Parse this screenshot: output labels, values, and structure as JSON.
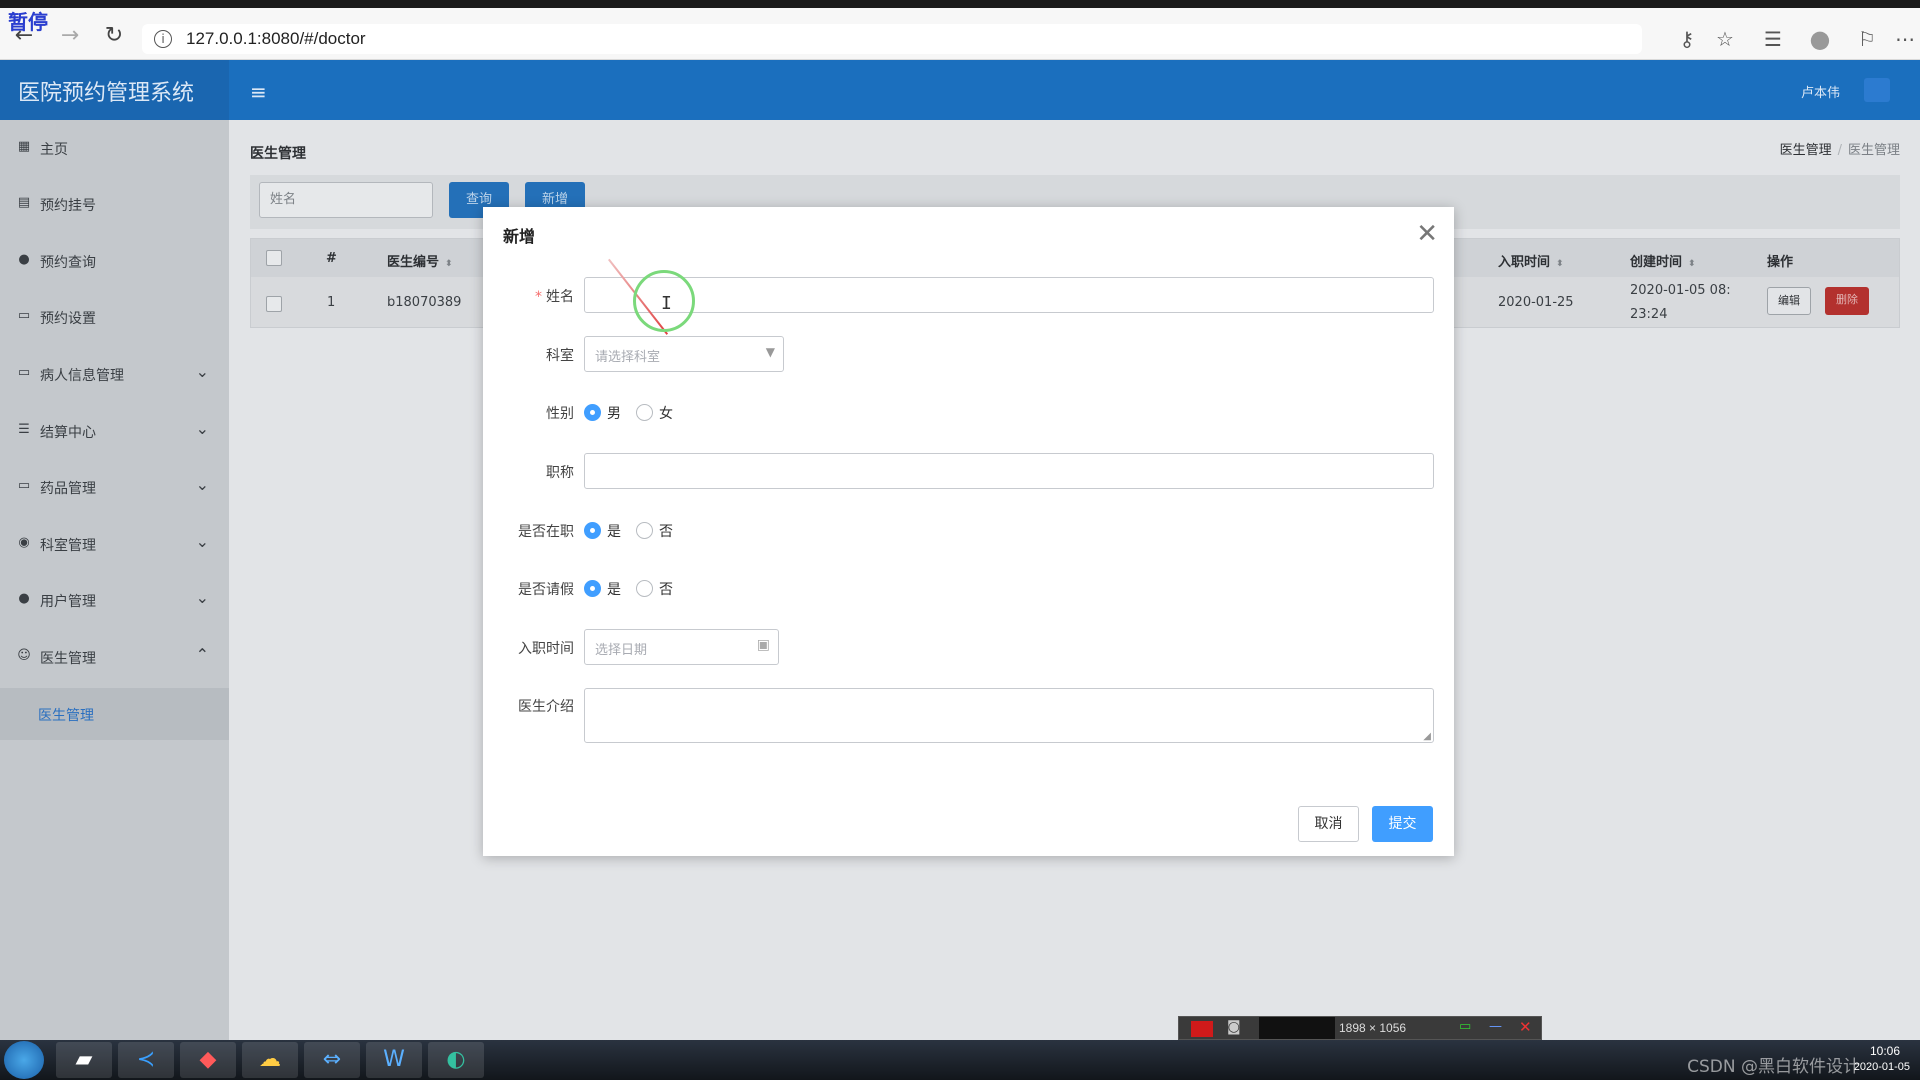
{
  "browser": {
    "pause_text": "暂停",
    "url": "127.0.0.1:8080/#/doctor",
    "back": "←",
    "forward": "→",
    "reload": "↻"
  },
  "app": {
    "title": "医院预约管理系统",
    "user": "卢本伟"
  },
  "sidebar": {
    "items": [
      {
        "label": "主页",
        "icon": "▦"
      },
      {
        "label": "预约挂号",
        "icon": "▤"
      },
      {
        "label": "预约查询",
        "icon": "●"
      },
      {
        "label": "预约设置",
        "icon": "▭"
      },
      {
        "label": "病人信息管理",
        "icon": "▭"
      },
      {
        "label": "结算中心",
        "icon": "☰"
      },
      {
        "label": "药品管理",
        "icon": "▭"
      },
      {
        "label": "科室管理",
        "icon": "◉"
      },
      {
        "label": "用户管理",
        "icon": "●"
      },
      {
        "label": "医生管理",
        "icon": "☺"
      }
    ],
    "sub_active": "医生管理"
  },
  "page": {
    "title": "医生管理",
    "breadcrumb": [
      "医生管理",
      "医生管理"
    ],
    "search_placeholder": "姓名",
    "query_btn": "查询",
    "add_btn": "新增"
  },
  "table": {
    "headers": {
      "index": "#",
      "code": "医生编号",
      "hire": "入职时间",
      "created": "创建时间",
      "ops": "操作"
    },
    "row": {
      "index": "1",
      "code": "b18070389",
      "hire": "2020-01-25",
      "created_line1": "2020-01-05 08:",
      "created_line2": "23:24",
      "edit": "编辑",
      "delete": "删除"
    }
  },
  "modal": {
    "title": "新增",
    "fields": {
      "name_label": "姓名",
      "dept_label": "科室",
      "dept_placeholder": "请选择科室",
      "gender_label": "性别",
      "gender_male": "男",
      "gender_female": "女",
      "title_label": "职称",
      "onduty_label": "是否在职",
      "yes": "是",
      "no": "否",
      "leave_label": "是否请假",
      "hire_label": "入职时间",
      "hire_placeholder": "选择日期",
      "intro_label": "医生介绍"
    },
    "cancel": "取消",
    "submit": "提交"
  },
  "recorder": {
    "size": "1898 × 1056"
  },
  "taskbar": {
    "time": "10:06",
    "date": "2020-01-05",
    "watermark": "CSDN @黑白软件设计"
  }
}
